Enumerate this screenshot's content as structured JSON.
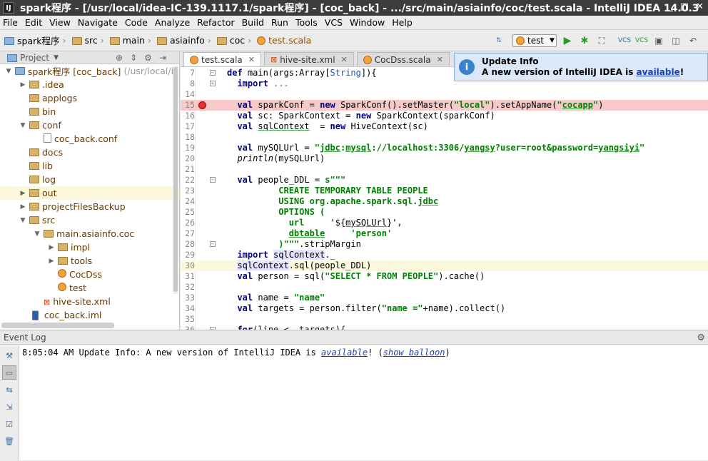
{
  "window": {
    "title": "spark程序 - [/usr/local/idea-IC-139.1117.1/spark程序] - [coc_back] - .../src/main/asiainfo/coc/test.scala - IntelliJ IDEA 14.0.3",
    "logo": "IJ",
    "controls": [
      "_",
      "□",
      "✕"
    ]
  },
  "menu": [
    "File",
    "Edit",
    "View",
    "Navigate",
    "Code",
    "Analyze",
    "Refactor",
    "Build",
    "Run",
    "Tools",
    "VCS",
    "Window",
    "Help"
  ],
  "breadcrumbs": [
    "spark程序",
    "src",
    "main",
    "asiainfo",
    "coc",
    "test.scala"
  ],
  "run_config": "test",
  "project": {
    "header": "Project",
    "tree": [
      {
        "label": "spark程序 [coc_back]",
        "extra": "(/usr/local/id",
        "depth": 0,
        "arrow": "▼",
        "icon": "folder-blue"
      },
      {
        "label": ".idea",
        "depth": 1,
        "arrow": "▶",
        "icon": "folder"
      },
      {
        "label": "applogs",
        "depth": 1,
        "arrow": "",
        "icon": "folder"
      },
      {
        "label": "bin",
        "depth": 1,
        "arrow": "",
        "icon": "folder"
      },
      {
        "label": "conf",
        "depth": 1,
        "arrow": "▼",
        "icon": "folder"
      },
      {
        "label": "coc_back.conf",
        "depth": 2,
        "arrow": "",
        "icon": "file"
      },
      {
        "label": "docs",
        "depth": 1,
        "arrow": "",
        "icon": "folder"
      },
      {
        "label": "lib",
        "depth": 1,
        "arrow": "",
        "icon": "folder"
      },
      {
        "label": "log",
        "depth": 1,
        "arrow": "",
        "icon": "folder"
      },
      {
        "label": "out",
        "depth": 1,
        "arrow": "▶",
        "icon": "folder",
        "selected": true
      },
      {
        "label": "projectFilesBackup",
        "depth": 1,
        "arrow": "▶",
        "icon": "folder"
      },
      {
        "label": "src",
        "depth": 1,
        "arrow": "▼",
        "icon": "folder"
      },
      {
        "label": "main.asiainfo.coc",
        "depth": 2,
        "arrow": "▼",
        "icon": "folder"
      },
      {
        "label": "impl",
        "depth": 3,
        "arrow": "▶",
        "icon": "folder"
      },
      {
        "label": "tools",
        "depth": 3,
        "arrow": "▶",
        "icon": "folder"
      },
      {
        "label": "CocDss",
        "depth": 3,
        "arrow": "",
        "icon": "scala"
      },
      {
        "label": "test",
        "depth": 3,
        "arrow": "",
        "icon": "scala"
      },
      {
        "label": "hive-site.xml",
        "depth": 2,
        "arrow": "",
        "icon": "xml"
      },
      {
        "label": "coc_back.iml",
        "depth": 1,
        "arrow": "",
        "icon": "iml"
      }
    ]
  },
  "tabs": [
    {
      "label": "test.scala",
      "active": true,
      "icon": "scala"
    },
    {
      "label": "hive-site.xml",
      "active": false,
      "icon": "xml"
    },
    {
      "label": "CocDss.scala",
      "active": false,
      "icon": "scala"
    }
  ],
  "balloon": {
    "title": "Update Info",
    "text": "A new version of IntelliJ IDEA is ",
    "link": "available",
    "tail": "!"
  },
  "code": [
    {
      "n": "7",
      "html": "<span class='kw'>def</span> main(args:Array[<span class='ty'>String</span>]){",
      "fold": "−"
    },
    {
      "n": "8",
      "html": "  <span class='kw'>import</span> <span style='color:#666'>...</span>",
      "fold": "+"
    },
    {
      "n": "14",
      "html": ""
    },
    {
      "n": "15",
      "html": "  <span class='kw'>val</span> sparkConf = <span class='kw'>new</span> SparkConf().setMaster(<span class='str'>\"local\"</span>).setAppName(<span class='str'>\"<span class='under'>cocapp</span>\"</span>)",
      "error": true,
      "bp": true
    },
    {
      "n": "16",
      "html": "  <span class='kw'>val</span> sc: SparkContext = <span class='kw'>new</span> SparkContext(sparkConf)"
    },
    {
      "n": "17",
      "html": "  <span class='kw'>val</span> <span class='under'>sqlContext</span>  = <span class='kw'>new</span> HiveContext(sc)"
    },
    {
      "n": "18",
      "html": ""
    },
    {
      "n": "19",
      "html": "  <span class='kw'>val</span> mySQLUrl = <span class='str'>\"<span class='under'>jdbc</span>:<span class='under'>mysql</span>://localhost:3306/<span class='under'>yangsy</span>?user=root&amp;password=<span class='under'>yangsiyi</span>\"</span>"
    },
    {
      "n": "20",
      "html": "  <span class='itl'>println</span>(mySQLUrl)"
    },
    {
      "n": "21",
      "html": ""
    },
    {
      "n": "22",
      "html": "  <span class='kw'>val</span> people_DDL = <span class='str'>s\"\"\"</span>",
      "fold": "−"
    },
    {
      "n": "23",
      "html": "<span class='str'>          CREATE TEMPORARY TABLE PEOPLE</span>"
    },
    {
      "n": "24",
      "html": "<span class='str'>          USING org.apache.spark.sql.<span class='under'>jdbc</span></span>"
    },
    {
      "n": "25",
      "html": "<span class='str'>          OPTIONS (</span>"
    },
    {
      "n": "26",
      "html": "<span class='str'>            url     '</span>${<span class='under'>mySQLUrl</span>}<span class='str'>',</span>"
    },
    {
      "n": "27",
      "html": "<span class='str'>            <span class='under'>dbtable</span>     'person'</span>"
    },
    {
      "n": "28",
      "html": "<span class='str'>          )\"\"\"</span>.stripMargin",
      "fold": "−"
    },
    {
      "n": "29",
      "html": "  <span class='kw'>import</span> <span style='background:#e4e4ff'>sqlContext</span>._"
    },
    {
      "n": "30",
      "html": "  <span style='background:#e4e4ff'>sqlContext</span>.sql(people_DDL)",
      "current": true
    },
    {
      "n": "31",
      "html": "  <span class='kw'>val</span> person = sql(<span class='str'>\"SELECT * FROM PEOPLE\"</span>).cache()"
    },
    {
      "n": "32",
      "html": ""
    },
    {
      "n": "33",
      "html": "  <span class='kw'>val</span> name = <span class='str'>\"name\"</span>"
    },
    {
      "n": "34",
      "html": "  <span class='kw'>val</span> targets = person.filter(<span class='str'>\"name =\"</span>+name).collect()"
    },
    {
      "n": "35",
      "html": ""
    },
    {
      "n": "36",
      "html": "  <span class='kw'>for</span>(line &lt;- targets){",
      "fold": "−"
    }
  ],
  "event_log": {
    "header": "Event Log",
    "time": "8:05:04 AM",
    "message": " Update Info: A new version of IntelliJ IDEA is ",
    "link": "available",
    "mid": "! (",
    "link2": "show balloon",
    "end": ")"
  }
}
